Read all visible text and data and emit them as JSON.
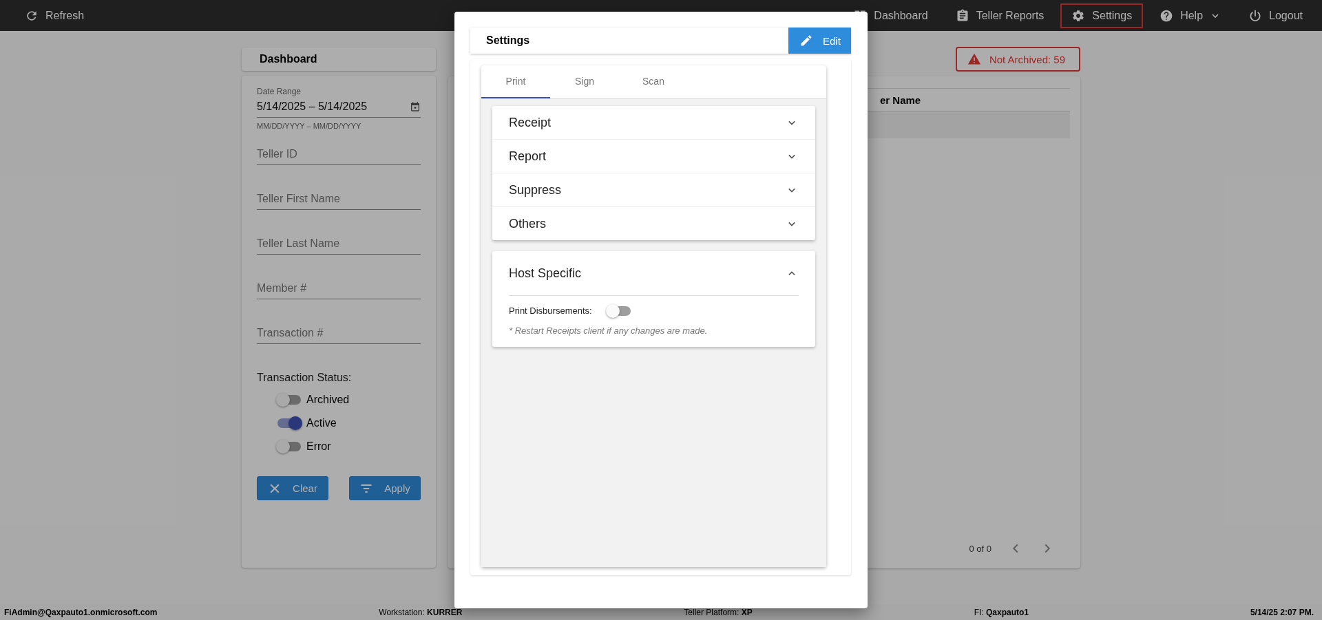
{
  "top_bar": {
    "refresh": {
      "label": "Refresh"
    },
    "nav": [
      {
        "label": "Dashboard",
        "selected": false,
        "dropdown": false
      },
      {
        "label": "Teller Reports",
        "selected": false,
        "dropdown": false
      },
      {
        "label": "Settings",
        "selected": true,
        "dropdown": false
      },
      {
        "label": "Help",
        "selected": false,
        "dropdown": true
      },
      {
        "label": "Logout",
        "selected": false,
        "dropdown": false
      }
    ]
  },
  "dashboard": {
    "title": "Dashboard",
    "date_range": {
      "label": "Date Range",
      "value": "5/14/2025 – 5/14/2025",
      "hint": "MM/DD/YYYY – MM/DD/YYYY"
    },
    "fields": [
      {
        "placeholder": "Teller ID"
      },
      {
        "placeholder": "Teller First Name"
      },
      {
        "placeholder": "Teller Last Name"
      },
      {
        "placeholder": "Member #"
      },
      {
        "placeholder": "Transaction #"
      }
    ],
    "status": {
      "label": "Transaction Status:",
      "toggles": [
        {
          "label": "Archived",
          "checked": false
        },
        {
          "label": "Active",
          "checked": true
        },
        {
          "label": "Error",
          "checked": false
        }
      ]
    },
    "buttons": [
      {
        "label": "Clear"
      },
      {
        "label": "Apply"
      }
    ]
  },
  "results": {
    "badge": "Not Archived: 59",
    "table": {
      "columns": [
        "er Name"
      ],
      "rows": [
        {
          "selected": true
        }
      ]
    },
    "pagination": "0 of 0"
  },
  "settings_dialog": {
    "title": "Settings",
    "edit_button": "Edit",
    "tabs": [
      {
        "label": "Print",
        "selected": true
      },
      {
        "label": "Sign",
        "selected": false
      },
      {
        "label": "Scan",
        "selected": false
      }
    ],
    "panels": [
      {
        "title": "Receipt",
        "expanded": false
      },
      {
        "title": "Report",
        "expanded": false
      },
      {
        "title": "Suppress",
        "expanded": false
      },
      {
        "title": "Others",
        "expanded": false
      },
      {
        "title": "Host Specific",
        "expanded": true,
        "fields": [
          {
            "label": "Print Disbursements:",
            "kind": "toggle",
            "checked": false
          }
        ],
        "note": "* Restart Receipts client if any changes are made."
      }
    ]
  },
  "status_bar": [
    {
      "text": "FiAdmin@Qaxpauto1.onmicrosoft.com",
      "bold": true
    },
    {
      "text": "Workstation: **KURRER**",
      "bold": false
    },
    {
      "text": "Teller Platform: **XP**",
      "bold": false
    },
    {
      "text": "FI: **Qaxpauto1**",
      "bold": false
    },
    {
      "text": "5/14/25 2:07 PM.",
      "bold": true
    }
  ]
}
